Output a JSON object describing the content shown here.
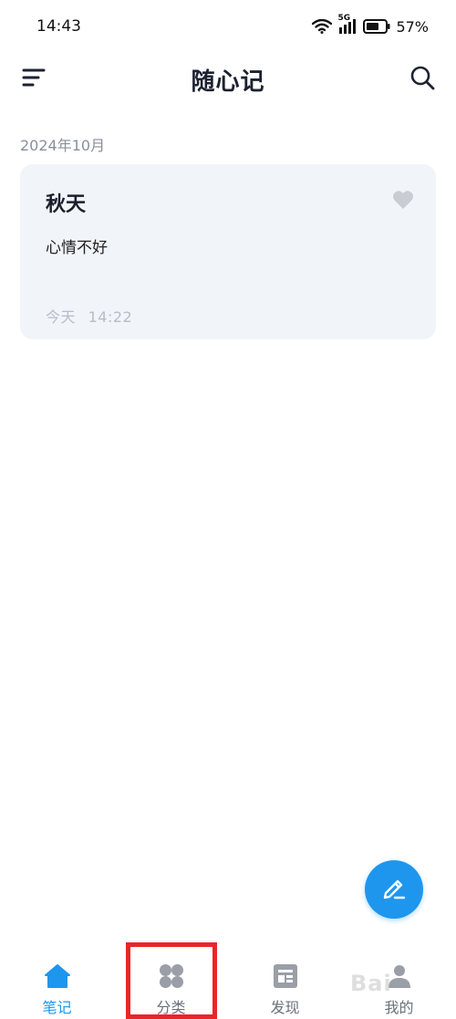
{
  "status_bar": {
    "time": "14:43",
    "network": "5G",
    "battery": "57%",
    "icons": [
      "wifi-icon",
      "signal-icon",
      "battery-icon"
    ]
  },
  "app_bar": {
    "title": "随心记",
    "left_icon": "menu-icon",
    "right_icon": "search-icon"
  },
  "notes_section": {
    "month_header": "2024年10月",
    "notes": [
      {
        "title": "秋天",
        "content": "心情不好",
        "date": "今天",
        "time": "14:22",
        "favorite_icon": "heart-icon"
      }
    ]
  },
  "fab": {
    "icon": "pencil-icon"
  },
  "bottom_nav": {
    "items": [
      {
        "label": "笔记",
        "icon": "home-icon",
        "active": true
      },
      {
        "label": "分类",
        "icon": "category-icon",
        "active": false
      },
      {
        "label": "发现",
        "icon": "discover-icon",
        "active": false
      },
      {
        "label": "我的",
        "icon": "profile-icon",
        "active": false
      }
    ]
  },
  "watermark": "Bai",
  "colors": {
    "accent": "#1e96ee",
    "highlight": "#e8262a",
    "card_bg": "#f1f4f9",
    "text_primary": "#1a1f2b",
    "text_muted": "#8a8f99"
  }
}
